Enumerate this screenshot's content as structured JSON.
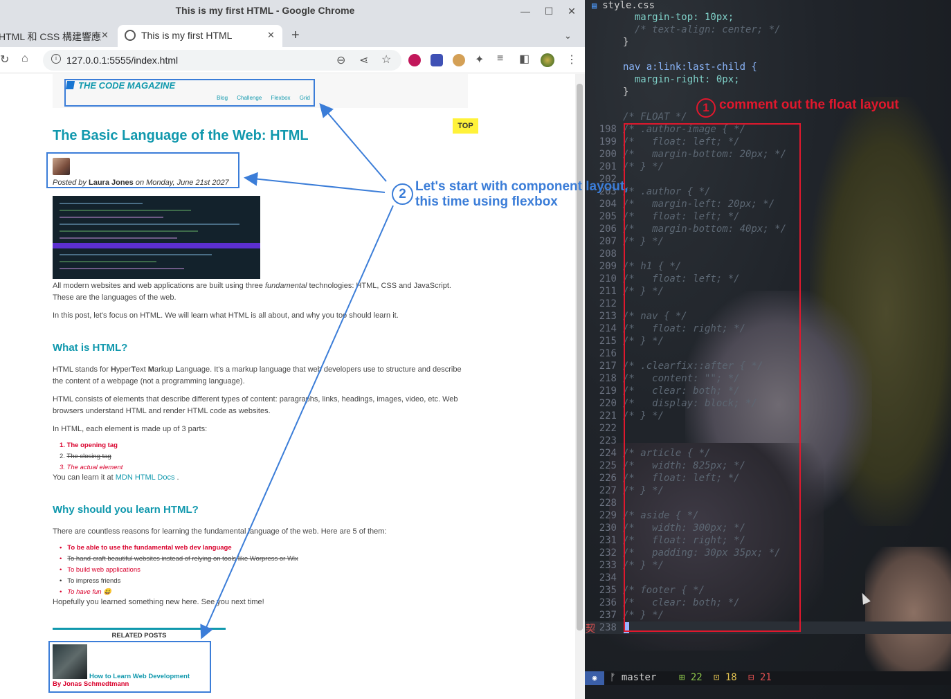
{
  "window": {
    "title": "This is my first HTML - Google Chrome",
    "minimize": "—",
    "maximize": "☐",
    "close": "✕"
  },
  "tabs": [
    {
      "label": "HTML 和 CSS 構建響應",
      "close": "✕"
    },
    {
      "label": "This is my first HTML",
      "close": "✕"
    }
  ],
  "toolbar": {
    "url": "127.0.0.1:5555/index.html",
    "new_tab": "+",
    "tab_menu": "⌄"
  },
  "page": {
    "logo": "THE CODE MAGAZINE",
    "nav": [
      "Blog",
      "Challenge",
      "Flexbox",
      "Grid"
    ],
    "top_button": "TOP",
    "h1": "The Basic Language of the Web: HTML",
    "posted_prefix": "Posted by ",
    "author": "Laura Jones",
    "posted_suffix": " on Monday, June 21st 2027",
    "intro_p1_a": "All modern websites and web applications are built using three ",
    "intro_p1_em": "fundamental",
    "intro_p1_b": " technologies: HTML, CSS and JavaScript. These are the languages of the web.",
    "intro_p2": "In this post, let's focus on HTML. We will learn what HTML is all about, and why you too should learn it.",
    "h2_what": "What is HTML?",
    "what_p1_a": "HTML stands for ",
    "what_p1_h": "H",
    "what_p1_b": "yper",
    "what_p1_t": "T",
    "what_p1_c": "ext ",
    "what_p1_m": "M",
    "what_p1_d": "arkup ",
    "what_p1_l": "L",
    "what_p1_e": "anguage. It's a markup language that web developers use to structure and describe the content of a webpage (not a programming language).",
    "what_p2": "HTML consists of elements that describe different types of content: paragraphs, links, headings, images, video, etc. Web browsers understand HTML and render HTML code as websites.",
    "what_p3": "In HTML, each element is made up of 3 parts:",
    "parts": [
      "The opening tag",
      "The closing tag",
      "The actual element"
    ],
    "learn_prefix": "You can learn it at ",
    "learn_link": "MDN HTML Docs",
    "learn_suffix": " .",
    "h2_why": "Why should you learn HTML?",
    "why_p1": "There are countless reasons for learning the fundamental language of the web. Here are 5 of them:",
    "reasons": [
      "To be able to use the fundamental web dev language",
      "To hand-craft beautiful websites instead of relying on tools like Worpress or Wix",
      "To build web applications",
      "To impress friends",
      "To have fun 😃"
    ],
    "closing": "Hopefully you learned something new here. See you next time!",
    "related_heading": "RELATED POSTS",
    "related_title": "How to Learn Web Development",
    "related_author": "By Jonas Schmedtmann"
  },
  "editor": {
    "filename": "style.css",
    "lines": [
      {
        "n": "",
        "t": "  margin-top: 10px;",
        "k": "decl"
      },
      {
        "n": "",
        "t": "  /* text-align: center; */",
        "k": "cmt"
      },
      {
        "n": "",
        "t": "}",
        "k": "plain"
      },
      {
        "n": "",
        "t": "",
        "k": "plain"
      },
      {
        "n": "",
        "t": "nav a:link:last-child {",
        "k": "sel"
      },
      {
        "n": "",
        "t": "  margin-right: 0px;",
        "k": "decl"
      },
      {
        "n": "",
        "t": "}",
        "k": "plain"
      },
      {
        "n": "",
        "t": "",
        "k": "plain"
      },
      {
        "n": "",
        "t": "/* FLOAT */",
        "k": "cmt"
      },
      {
        "n": "198",
        "t": "/* .author-image { */",
        "k": "cmt"
      },
      {
        "n": "199",
        "t": "/*   float: left; */",
        "k": "cmt"
      },
      {
        "n": "200",
        "t": "/*   margin-bottom: 20px; */",
        "k": "cmt"
      },
      {
        "n": "201",
        "t": "/* } */",
        "k": "cmt"
      },
      {
        "n": "202",
        "t": "",
        "k": "plain"
      },
      {
        "n": "203",
        "t": "/* .author { */",
        "k": "cmt"
      },
      {
        "n": "204",
        "t": "/*   margin-left: 20px; */",
        "k": "cmt"
      },
      {
        "n": "205",
        "t": "/*   float: left; */",
        "k": "cmt"
      },
      {
        "n": "206",
        "t": "/*   margin-bottom: 40px; */",
        "k": "cmt"
      },
      {
        "n": "207",
        "t": "/* } */",
        "k": "cmt"
      },
      {
        "n": "208",
        "t": "",
        "k": "plain"
      },
      {
        "n": "209",
        "t": "/* h1 { */",
        "k": "cmt"
      },
      {
        "n": "210",
        "t": "/*   float: left; */",
        "k": "cmt"
      },
      {
        "n": "211",
        "t": "/* } */",
        "k": "cmt"
      },
      {
        "n": "212",
        "t": "",
        "k": "plain"
      },
      {
        "n": "213",
        "t": "/* nav { */",
        "k": "cmt"
      },
      {
        "n": "214",
        "t": "/*   float: right; */",
        "k": "cmt"
      },
      {
        "n": "215",
        "t": "/* } */",
        "k": "cmt"
      },
      {
        "n": "216",
        "t": "",
        "k": "plain"
      },
      {
        "n": "217",
        "t": "/* .clearfix::after { */",
        "k": "cmt"
      },
      {
        "n": "218",
        "t": "/*   content: \"\"; */",
        "k": "cmt"
      },
      {
        "n": "219",
        "t": "/*   clear: both; */",
        "k": "cmt"
      },
      {
        "n": "220",
        "t": "/*   display: block; */",
        "k": "cmt"
      },
      {
        "n": "221",
        "t": "/* } */",
        "k": "cmt"
      },
      {
        "n": "222",
        "t": "",
        "k": "plain"
      },
      {
        "n": "223",
        "t": "",
        "k": "plain"
      },
      {
        "n": "224",
        "t": "/* article { */",
        "k": "cmt"
      },
      {
        "n": "225",
        "t": "/*   width: 825px; */",
        "k": "cmt"
      },
      {
        "n": "226",
        "t": "/*   float: left; */",
        "k": "cmt"
      },
      {
        "n": "227",
        "t": "/* } */",
        "k": "cmt"
      },
      {
        "n": "228",
        "t": "",
        "k": "plain"
      },
      {
        "n": "229",
        "t": "/* aside { */",
        "k": "cmt"
      },
      {
        "n": "230",
        "t": "/*   width: 300px; */",
        "k": "cmt"
      },
      {
        "n": "231",
        "t": "/*   float: right; */",
        "k": "cmt"
      },
      {
        "n": "232",
        "t": "/*   padding: 30px 35px; */",
        "k": "cmt"
      },
      {
        "n": "233",
        "t": "/* } */",
        "k": "cmt"
      },
      {
        "n": "234",
        "t": "",
        "k": "plain"
      },
      {
        "n": "235",
        "t": "/* footer { */",
        "k": "cmt"
      },
      {
        "n": "236",
        "t": "/*   clear: both; */",
        "k": "cmt"
      },
      {
        "n": "237",
        "t": "/* } */",
        "k": "cmt"
      },
      {
        "n": "238",
        "t": "",
        "k": "plain"
      }
    ],
    "gutter_mark": "契",
    "status": {
      "mode": "◉",
      "branch": "ᚠ master",
      "added": "⊞ 22",
      "changed": "⊡ 18",
      "removed": "⊟ 21"
    }
  },
  "annotations": {
    "step1_num": "1",
    "step1_text": "comment out the float layout",
    "step2_num": "2",
    "step2_line1": "Let's start with component layout,",
    "step2_line2": "this time using flexbox"
  },
  "colors": {
    "accent": "#1098ad",
    "red_annotation": "#e0182d",
    "blue_annotation": "#3b7dd8"
  }
}
